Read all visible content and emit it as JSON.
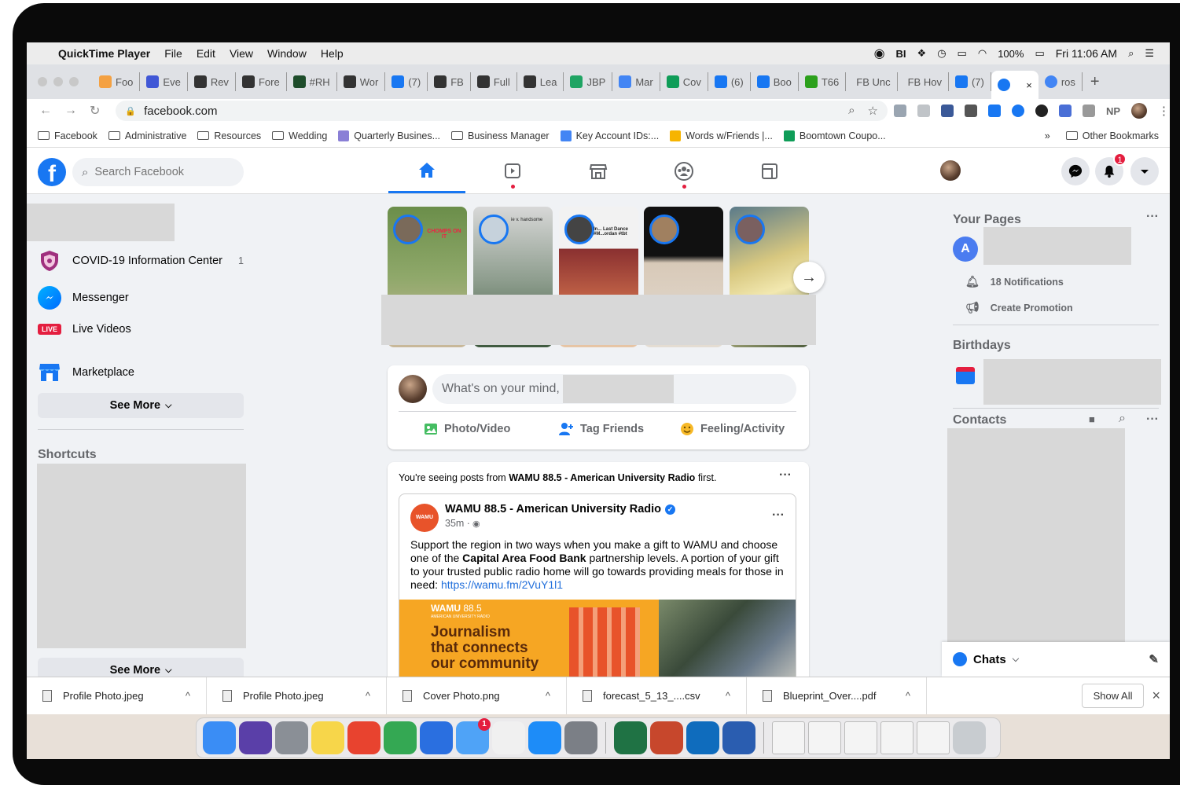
{
  "menubar": {
    "app": "QuickTime Player",
    "items": [
      "File",
      "Edit",
      "View",
      "Window",
      "Help"
    ],
    "battery": "100%",
    "clock": "Fri 11:06 AM"
  },
  "tabs": [
    {
      "label": "Foo",
      "color": "#f4a142"
    },
    {
      "label": "Eve",
      "color": "#4057d6"
    },
    {
      "label": "Rev",
      "color": "#333333"
    },
    {
      "label": "Fore",
      "color": "#333333"
    },
    {
      "label": "#RH",
      "color": "#1e4d2b"
    },
    {
      "label": "Wor",
      "color": "#333333"
    },
    {
      "label": "(7)",
      "color": "#1877f2"
    },
    {
      "label": "FB",
      "color": "#333333"
    },
    {
      "label": "Full",
      "color": "#333333"
    },
    {
      "label": "Lea",
      "color": "#333333"
    },
    {
      "label": "JBP",
      "color": "#1fa463"
    },
    {
      "label": "Mar",
      "color": "#4285f4"
    },
    {
      "label": "Cov",
      "color": "#0f9d58"
    },
    {
      "label": "(6)",
      "color": "#1877f2"
    },
    {
      "label": "Boo",
      "color": "#1877f2"
    },
    {
      "label": "T66",
      "color": "#2ca01c"
    },
    {
      "label": "FB Unc",
      "color": "#ffffff"
    },
    {
      "label": "FB Hov",
      "color": "#ffffff"
    },
    {
      "label": "(7)",
      "color": "#1877f2"
    }
  ],
  "active_tab_close": "×",
  "tab_after": {
    "label": "ros",
    "color": "#4285f4"
  },
  "new_tab": "+",
  "address": {
    "url": "facebook.com"
  },
  "bookmarks": [
    {
      "label": "Facebook",
      "type": "folder"
    },
    {
      "label": "Administrative",
      "type": "folder"
    },
    {
      "label": "Resources",
      "type": "folder"
    },
    {
      "label": "Wedding",
      "type": "folder"
    },
    {
      "label": "Quarterly Busines...",
      "type": "icon",
      "color": "#8a7fd6"
    },
    {
      "label": "Business Manager",
      "type": "folder"
    },
    {
      "label": "Key Account IDs:...",
      "type": "icon",
      "color": "#4285f4"
    },
    {
      "label": "Words w/Friends |...",
      "type": "icon",
      "color": "#f6b400"
    },
    {
      "label": "Boomtown Coupo...",
      "type": "icon",
      "color": "#0f9d58"
    }
  ],
  "bookmarks_more": "»",
  "other_bookmarks": "Other Bookmarks",
  "search": {
    "placeholder": "Search Facebook"
  },
  "notifications_badge": "1",
  "left_menu": [
    {
      "label": "COVID-19 Information Center",
      "count": "1",
      "icon": "covid-shield-icon",
      "color": "#a0307e"
    },
    {
      "label": "Messenger",
      "icon": "messenger-icon",
      "color": "#1877f2"
    },
    {
      "label": "Live Videos",
      "icon": "live-icon",
      "color": "#e41e3f",
      "badge_text": "LIVE"
    },
    {
      "label": "Marketplace",
      "icon": "marketplace-icon",
      "color": "#1877f2"
    }
  ],
  "see_more": "See More",
  "shortcuts_title": "Shortcuts",
  "see_more_2": "See More",
  "composer": {
    "placeholder": "What's on your mind,",
    "actions": [
      {
        "label": "Photo/Video",
        "color": "#45bd62"
      },
      {
        "label": "Tag Friends",
        "color": "#1877f2"
      },
      {
        "label": "Feeling/Activity",
        "color": "#f7b928"
      }
    ]
  },
  "post": {
    "prefix": "You're seeing posts from",
    "source": "WAMU 88.5 - American University Radio",
    "suffix": "first.",
    "page_name": "WAMU 88.5 - American University Radio",
    "time": "35m ·",
    "avatar_text": "WAMU 88.5",
    "body_1": "Support the region in two ways when you make a gift to WAMU and choose one of the",
    "body_bold": "Capital Area Food Bank",
    "body_2": "partnership levels. A portion of your gift to your trusted public radio home will go towards providing meals for those in need:",
    "link": "https://wamu.fm/2VuY1l1",
    "ad_logo": "WAMU",
    "ad_logo_num": "88.5",
    "ad_sub": "AMERICAN UNIVERSITY RADIO",
    "ad_headline": [
      "Journalism",
      "that connects",
      "our community"
    ]
  },
  "stories": [
    {
      "caption": "CHOMPS ON IT"
    },
    {
      "caption": "ie v. handsome"
    },
    {
      "caption": "In... Last Dance #M...ordan #tbt"
    },
    {
      "caption": ""
    },
    {
      "caption": ""
    }
  ],
  "right": {
    "your_pages": "Your Pages",
    "page_initial": "A",
    "notifications": "18 Notifications",
    "create_promotion": "Create Promotion",
    "birthdays": "Birthdays",
    "contacts": "Contacts",
    "more": "···"
  },
  "chats": {
    "label": "Chats"
  },
  "downloads": [
    {
      "name": "Profile Photo.jpeg"
    },
    {
      "name": "Profile Photo.jpeg"
    },
    {
      "name": "Cover Photo.png"
    },
    {
      "name": "forecast_5_13_....csv"
    },
    {
      "name": "Blueprint_Over....pdf"
    }
  ],
  "show_all": "Show All",
  "close_downloads": "×",
  "dock": [
    {
      "name": "Finder",
      "color": "#3a8df5"
    },
    {
      "name": "Siri",
      "color": "#5a3fa8"
    },
    {
      "name": "Launchpad",
      "color": "#8a8f96"
    },
    {
      "name": "Notes",
      "color": "#f7d64a"
    },
    {
      "name": "Help",
      "color": "#e8432f"
    },
    {
      "name": "Chrome",
      "color": "#34a853"
    },
    {
      "name": "BI",
      "color": "#2a6fe0"
    },
    {
      "name": "Messages",
      "color": "#4fa3f7",
      "badge": "1"
    },
    {
      "name": "News",
      "color": "#f0f0f0"
    },
    {
      "name": "App Store",
      "color": "#1d8cf8"
    },
    {
      "name": "System Preferences",
      "color": "#7b7f86"
    },
    {
      "name": "Excel",
      "color": "#1f7244"
    },
    {
      "name": "PowerPoint",
      "color": "#c7472c"
    },
    {
      "name": "Outlook",
      "color": "#0f6cbd"
    },
    {
      "name": "QuickTime",
      "color": "#2a5db0"
    },
    {
      "name": "Doc1",
      "color": "#f4f4f4"
    },
    {
      "name": "Doc2",
      "color": "#f4f4f4"
    },
    {
      "name": "Doc3",
      "color": "#f4f4f4"
    },
    {
      "name": "Doc4",
      "color": "#f4f4f4"
    },
    {
      "name": "Doc5",
      "color": "#f4f4f4"
    },
    {
      "name": "Trash",
      "color": "#c8ccd0"
    }
  ]
}
